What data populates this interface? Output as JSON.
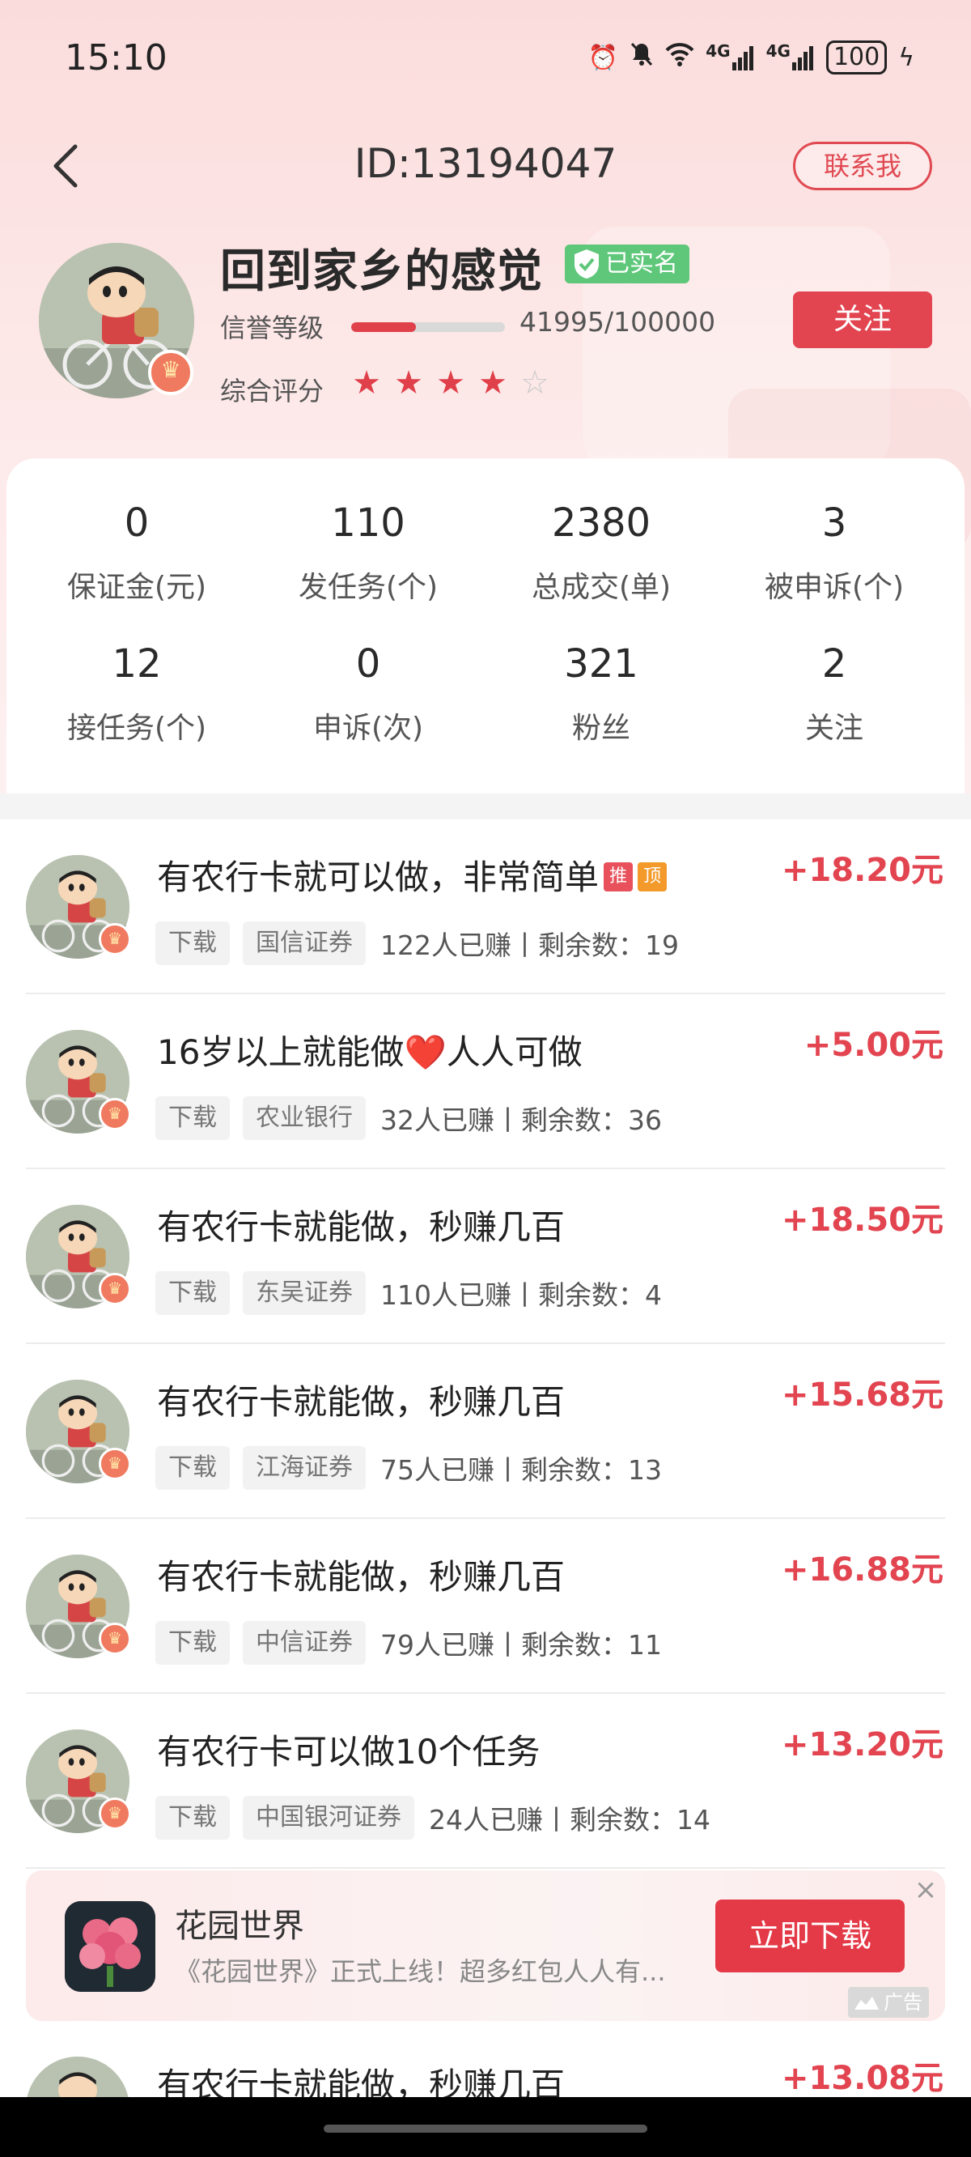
{
  "status_bar": {
    "time": "15:10",
    "signal1": "4G",
    "signal2": "4G",
    "battery": "100"
  },
  "header": {
    "title": "ID:13194047",
    "contact_label": "联系我"
  },
  "profile": {
    "username": "回到家乡的感觉",
    "verified_label": "已实名",
    "reputation_label": "信誉等级",
    "reputation_value": "41995/100000",
    "reputation_fraction": 0.42,
    "score_label": "综合评分",
    "stars_filled": 4,
    "stars_total": 5,
    "follow_label": "关注"
  },
  "stats": [
    {
      "value": "0",
      "label": "保证金(元)"
    },
    {
      "value": "110",
      "label": "发任务(个)"
    },
    {
      "value": "2380",
      "label": "总成交(单)"
    },
    {
      "value": "3",
      "label": "被申诉(个)"
    },
    {
      "value": "12",
      "label": "接任务(个)"
    },
    {
      "value": "0",
      "label": "申诉(次)"
    },
    {
      "value": "321",
      "label": "粉丝"
    },
    {
      "value": "2",
      "label": "关注"
    }
  ],
  "tasks": [
    {
      "title": "有农行卡就可以做，非常简单",
      "badges": [
        "推",
        "顶"
      ],
      "reward": "+18.20元",
      "tag1": "下载",
      "tag2": "国信证券",
      "meta": "122人已赚丨剩余数：19"
    },
    {
      "title": "16岁以上就能做❤️人人可做",
      "reward": "+5.00元",
      "tag1": "下载",
      "tag2": "农业银行",
      "meta": "32人已赚丨剩余数：36"
    },
    {
      "title": "有农行卡就能做，秒赚几百",
      "reward": "+18.50元",
      "tag1": "下载",
      "tag2": "东吴证券",
      "meta": "110人已赚丨剩余数：4"
    },
    {
      "title": "有农行卡就能做，秒赚几百",
      "reward": "+15.68元",
      "tag1": "下载",
      "tag2": "江海证券",
      "meta": "75人已赚丨剩余数：13"
    },
    {
      "title": "有农行卡就能做，秒赚几百",
      "reward": "+16.88元",
      "tag1": "下载",
      "tag2": "中信证券",
      "meta": "79人已赚丨剩余数：11"
    },
    {
      "title": "有农行卡可以做10个任务",
      "reward": "+13.20元",
      "tag1": "下载",
      "tag2": "中国银河证券",
      "meta": "24人已赚丨剩余数：14"
    }
  ],
  "ad": {
    "title": "花园世界",
    "desc": "《花园世界》正式上线！超多红包人人有...",
    "button_label": "立即下载",
    "ad_label": "广告",
    "close": "×"
  },
  "last_task": {
    "title": "有农行卡就能做，秒赚几百",
    "reward": "+13.08元"
  },
  "colors": {
    "accent": "#e24450",
    "verified": "#5ec77a"
  }
}
